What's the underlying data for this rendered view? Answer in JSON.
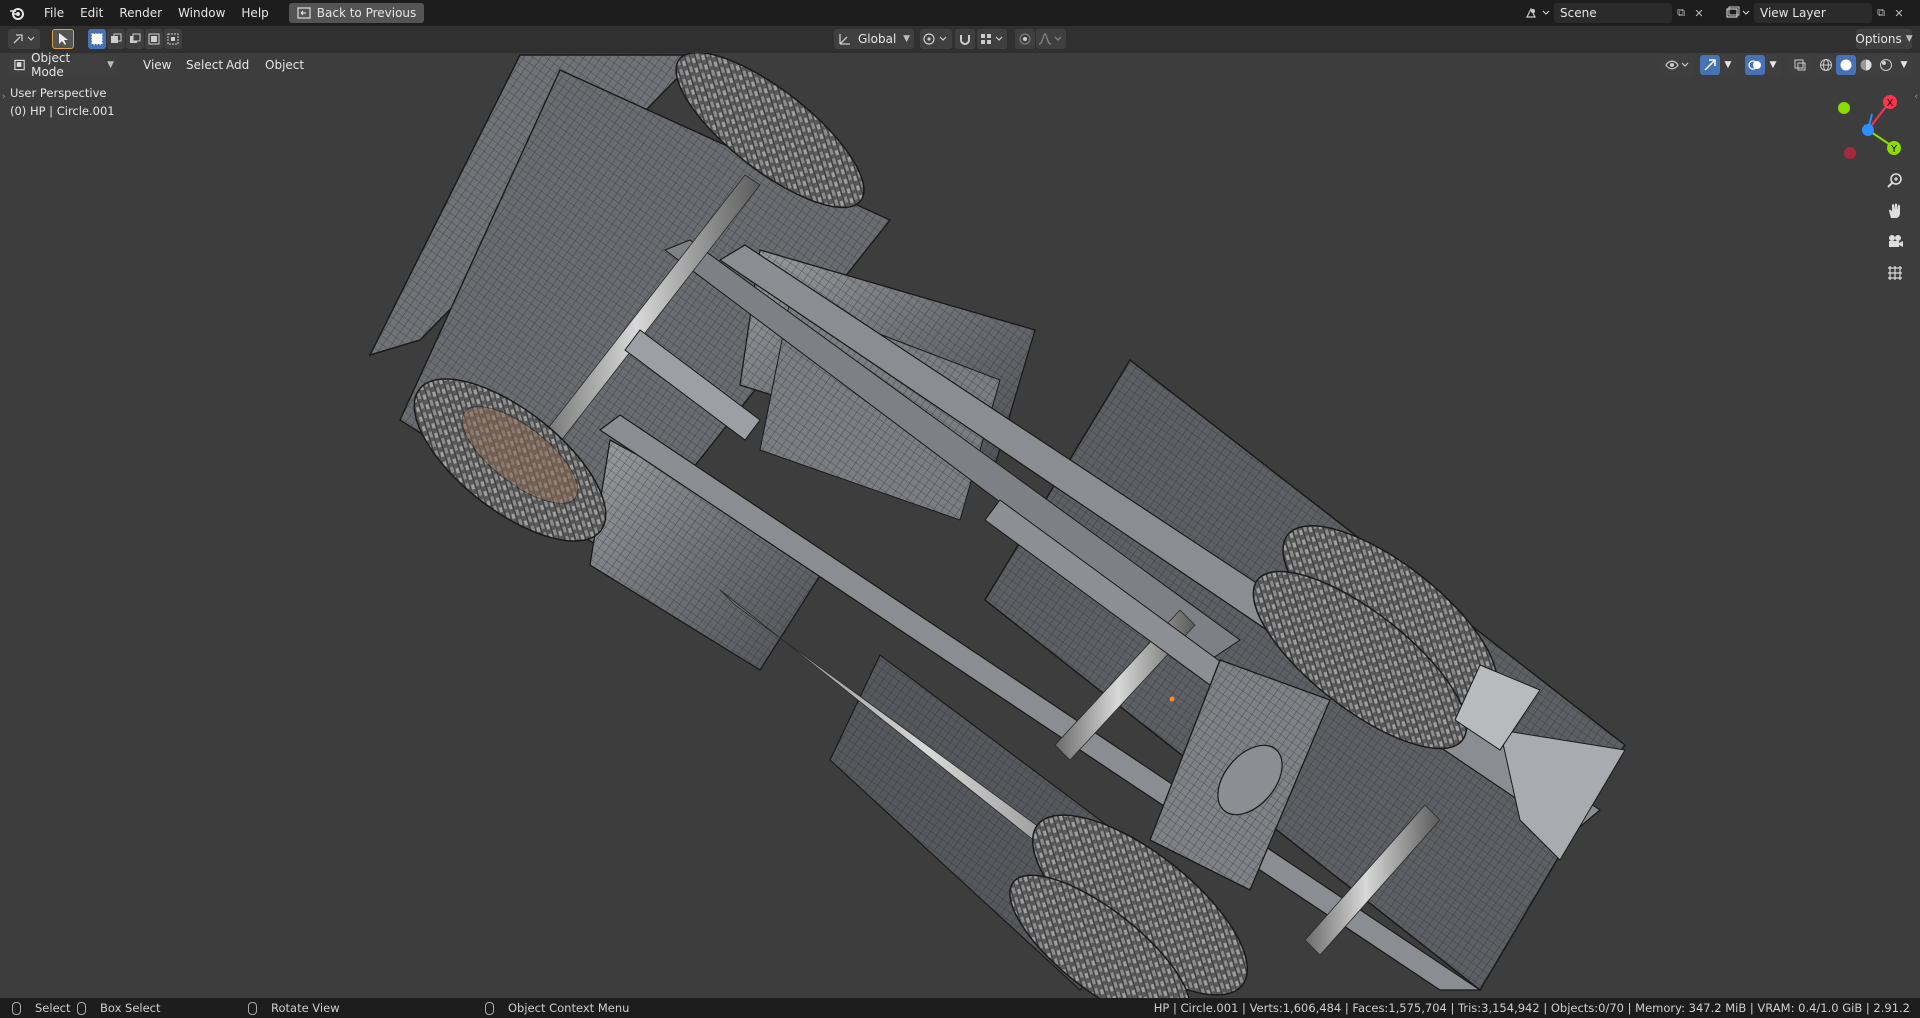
{
  "menubar": {
    "items": [
      "File",
      "Edit",
      "Render",
      "Window",
      "Help"
    ],
    "back_button": "Back to Previous",
    "scene_name": "Scene",
    "view_layer_name": "View Layer"
  },
  "toolbar": {
    "transform_orientation": "Global",
    "options_label": "Options"
  },
  "header": {
    "mode": "Object Mode",
    "menus": [
      "View",
      "Select",
      "Add",
      "Object"
    ]
  },
  "viewport": {
    "view_name": "User Perspective",
    "object_info": "(0) HP | Circle.001",
    "gizmo_axes": {
      "x": "X",
      "y": "Y"
    },
    "colors": {
      "x_axis": "#ff3352",
      "y_axis": "#8bdc00",
      "z_axis": "#2890ff",
      "background": "#3d3d3d"
    }
  },
  "statusbar": {
    "select": "Select",
    "box_select": "Box Select",
    "rotate_view": "Rotate View",
    "context_menu": "Object Context Menu",
    "stats": "HP | Circle.001 | Verts:1,606,484 | Faces:1,575,704 | Tris:3,154,942 | Objects:0/70 | Memory: 347.2 MiB | VRAM: 0.4/1.0 GiB | 2.91.2"
  },
  "icons": [
    "blender-logo-icon",
    "back-icon",
    "scene-icon",
    "view-layer-icon",
    "select-tool-icon",
    "transform-icon",
    "pivot-icon",
    "snap-icon",
    "proportional-icon",
    "visibility-icon",
    "gizmo-icon",
    "overlay-icon",
    "xray-icon",
    "wireframe-shading-icon",
    "solid-shading-icon",
    "material-shading-icon",
    "rendered-shading-icon",
    "zoom-icon",
    "hand-icon",
    "camera-icon",
    "grid-icon"
  ]
}
